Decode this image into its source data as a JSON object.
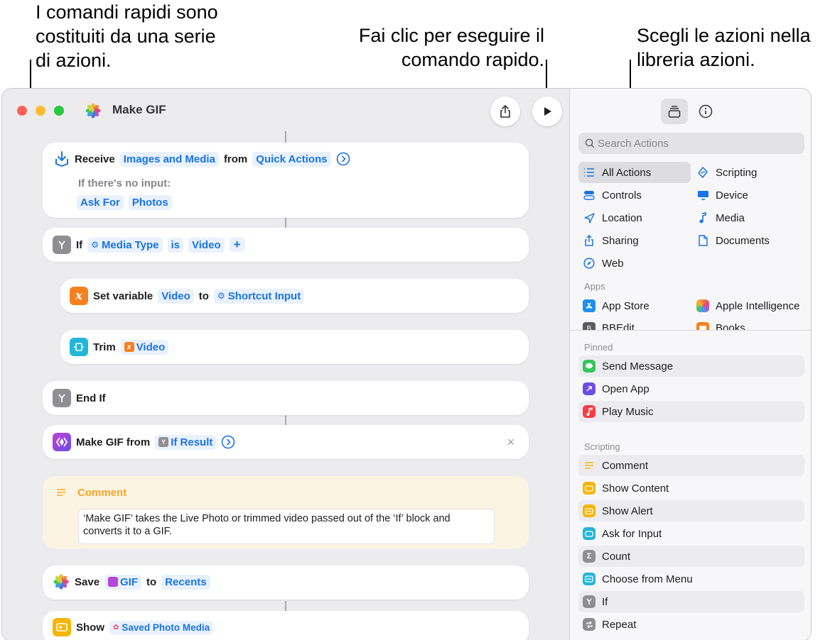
{
  "callouts": {
    "left": [
      "I comandi rapidi sono",
      "costituiti da una serie",
      "di azioni."
    ],
    "middle": [
      "Fai clic per eseguire il",
      "comando rapido."
    ],
    "right": [
      "Scegli le azioni nella",
      "libreria azioni."
    ]
  },
  "window": {
    "title": "Make GIF",
    "icons": {
      "share": "share-icon",
      "run": "play-icon",
      "library": "library-icon",
      "info": "info-icon"
    }
  },
  "actions": {
    "receive": {
      "label": "Receive",
      "token1": "Images and Media",
      "word_from": "from",
      "token2": "Quick Actions",
      "no_input_label": "If there's no input:",
      "ask_for": "Ask For",
      "photos": "Photos"
    },
    "if_block": {
      "label": "If",
      "var": "Media Type",
      "op": "is",
      "value": "Video"
    },
    "set_variable": {
      "label": "Set variable",
      "name": "Video",
      "word_to": "to",
      "value": "Shortcut Input"
    },
    "trim": {
      "label": "Trim",
      "value": "Video"
    },
    "end_if": {
      "label": "End If"
    },
    "make_gif": {
      "label": "Make GIF from",
      "value": "If Result"
    },
    "comment": {
      "title": "Comment",
      "text": "‘Make GIF’ takes the Live Photo or trimmed video passed out of the ‘If’ block and converts it to a GIF."
    },
    "save": {
      "label": "Save",
      "value": "GIF",
      "word_to": "to",
      "dest": "Recents"
    },
    "show": {
      "label": "Show",
      "value": "Saved Photo Media"
    }
  },
  "library": {
    "search_placeholder": "Search Actions",
    "categories_left": [
      "All Actions",
      "Controls",
      "Location",
      "Sharing",
      "Web"
    ],
    "categories_right": [
      "Scripting",
      "Device",
      "Media",
      "Documents"
    ],
    "apps_header": "Apps",
    "apps": [
      "App Store",
      "Apple Intelligence",
      "BBEdit",
      "Books"
    ],
    "pinned_header": "Pinned",
    "pinned": [
      "Send Message",
      "Open App",
      "Play Music"
    ],
    "scripting_header": "Scripting",
    "scripting": [
      "Comment",
      "Show Content",
      "Show Alert",
      "Ask for Input",
      "Count",
      "Choose from Menu",
      "If",
      "Repeat"
    ]
  },
  "colors": {
    "accent": "#1a73e8",
    "comment_bg": "#fbf4e3",
    "comment_title": "#f5a623"
  }
}
